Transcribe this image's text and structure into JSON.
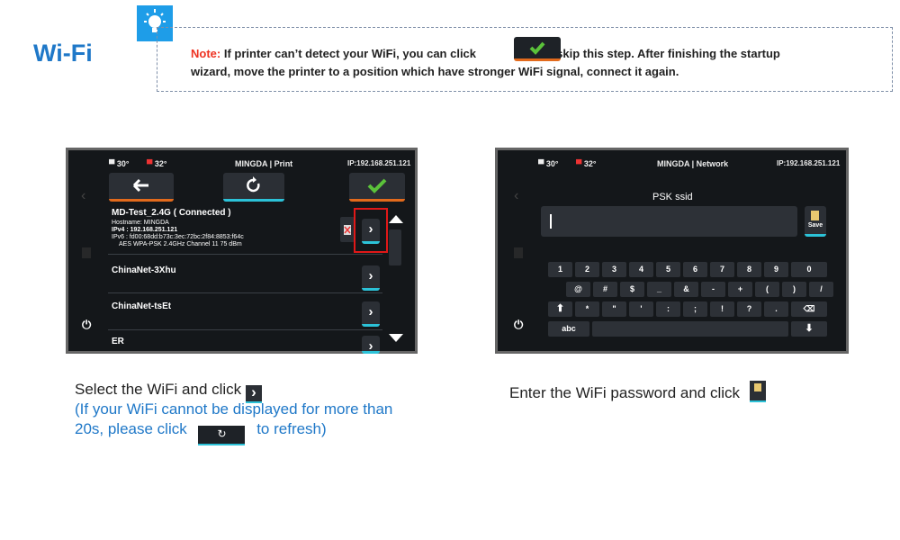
{
  "header": {
    "title": "Wi-Fi",
    "note_label": "Note:",
    "note_line1_a": "If printer can’t detect your WiFi, you can click",
    "note_line1_b": "to skip this step. After finishing the startup",
    "note_line2": "wizard, move the printer to a position which have stronger WiFi signal, connect it again."
  },
  "screen1": {
    "nozzle_temp": "30°",
    "bed_temp": "32°",
    "app_title": "MINGDA | Print",
    "ip": "IP:192.168.251.121",
    "connected": {
      "name": "MD-Test_2.4G ( Connected )",
      "hostname": "Hostname: MINGDA",
      "ipv4": "IPv4 : 192.168.251.121",
      "ipv6": "IPv6 : fd00:68dd:b73c:3ec:72bc:2f84:8853:f64c",
      "details": "AES WPA-PSK  2.4GHz Channel 11 75 dBm"
    },
    "networks": [
      "ChinaNet-3Xhu",
      "ChinaNet-tsEt",
      "ER"
    ]
  },
  "screen2": {
    "nozzle_temp": "30°",
    "bed_temp": "32°",
    "app_title": "MINGDA | Network",
    "ip": "IP:192.168.251.121",
    "psk_label": "PSK ssid",
    "save_label": "Save",
    "row1": [
      "1",
      "2",
      "3",
      "4",
      "5",
      "6",
      "7",
      "8",
      "9",
      "0"
    ],
    "row2": [
      "@",
      "#",
      "$",
      "_",
      "&",
      "-",
      "+",
      "(",
      ")",
      "/"
    ],
    "row3": [
      "\"",
      "'",
      ":",
      ";",
      "!",
      "?",
      "."
    ],
    "abc_label": "abc"
  },
  "captions": {
    "left_line1": "Select the WiFi and click",
    "left_line2": "(If your WiFi cannot be displayed for more than",
    "left_line3a": "20s, please click",
    "left_line3b": "to refresh)",
    "right_line1": "Enter the WiFi password and click"
  },
  "colors": {
    "accent_blue": "#1f78c8",
    "orange": "#e26a1c",
    "cyan": "#2cc2d8",
    "green_check": "#5bc23a",
    "red": "#e01818"
  }
}
